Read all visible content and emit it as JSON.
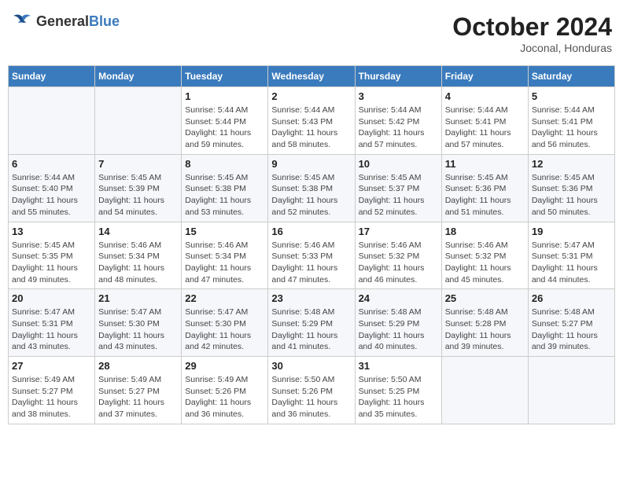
{
  "header": {
    "logo_general": "General",
    "logo_blue": "Blue",
    "month_year": "October 2024",
    "location": "Joconal, Honduras"
  },
  "days_of_week": [
    "Sunday",
    "Monday",
    "Tuesday",
    "Wednesday",
    "Thursday",
    "Friday",
    "Saturday"
  ],
  "weeks": [
    [
      {
        "day": "",
        "info": ""
      },
      {
        "day": "",
        "info": ""
      },
      {
        "day": "1",
        "info": "Sunrise: 5:44 AM\nSunset: 5:44 PM\nDaylight: 11 hours and 59 minutes."
      },
      {
        "day": "2",
        "info": "Sunrise: 5:44 AM\nSunset: 5:43 PM\nDaylight: 11 hours and 58 minutes."
      },
      {
        "day": "3",
        "info": "Sunrise: 5:44 AM\nSunset: 5:42 PM\nDaylight: 11 hours and 57 minutes."
      },
      {
        "day": "4",
        "info": "Sunrise: 5:44 AM\nSunset: 5:41 PM\nDaylight: 11 hours and 57 minutes."
      },
      {
        "day": "5",
        "info": "Sunrise: 5:44 AM\nSunset: 5:41 PM\nDaylight: 11 hours and 56 minutes."
      }
    ],
    [
      {
        "day": "6",
        "info": "Sunrise: 5:44 AM\nSunset: 5:40 PM\nDaylight: 11 hours and 55 minutes."
      },
      {
        "day": "7",
        "info": "Sunrise: 5:45 AM\nSunset: 5:39 PM\nDaylight: 11 hours and 54 minutes."
      },
      {
        "day": "8",
        "info": "Sunrise: 5:45 AM\nSunset: 5:38 PM\nDaylight: 11 hours and 53 minutes."
      },
      {
        "day": "9",
        "info": "Sunrise: 5:45 AM\nSunset: 5:38 PM\nDaylight: 11 hours and 52 minutes."
      },
      {
        "day": "10",
        "info": "Sunrise: 5:45 AM\nSunset: 5:37 PM\nDaylight: 11 hours and 52 minutes."
      },
      {
        "day": "11",
        "info": "Sunrise: 5:45 AM\nSunset: 5:36 PM\nDaylight: 11 hours and 51 minutes."
      },
      {
        "day": "12",
        "info": "Sunrise: 5:45 AM\nSunset: 5:36 PM\nDaylight: 11 hours and 50 minutes."
      }
    ],
    [
      {
        "day": "13",
        "info": "Sunrise: 5:45 AM\nSunset: 5:35 PM\nDaylight: 11 hours and 49 minutes."
      },
      {
        "day": "14",
        "info": "Sunrise: 5:46 AM\nSunset: 5:34 PM\nDaylight: 11 hours and 48 minutes."
      },
      {
        "day": "15",
        "info": "Sunrise: 5:46 AM\nSunset: 5:34 PM\nDaylight: 11 hours and 47 minutes."
      },
      {
        "day": "16",
        "info": "Sunrise: 5:46 AM\nSunset: 5:33 PM\nDaylight: 11 hours and 47 minutes."
      },
      {
        "day": "17",
        "info": "Sunrise: 5:46 AM\nSunset: 5:32 PM\nDaylight: 11 hours and 46 minutes."
      },
      {
        "day": "18",
        "info": "Sunrise: 5:46 AM\nSunset: 5:32 PM\nDaylight: 11 hours and 45 minutes."
      },
      {
        "day": "19",
        "info": "Sunrise: 5:47 AM\nSunset: 5:31 PM\nDaylight: 11 hours and 44 minutes."
      }
    ],
    [
      {
        "day": "20",
        "info": "Sunrise: 5:47 AM\nSunset: 5:31 PM\nDaylight: 11 hours and 43 minutes."
      },
      {
        "day": "21",
        "info": "Sunrise: 5:47 AM\nSunset: 5:30 PM\nDaylight: 11 hours and 43 minutes."
      },
      {
        "day": "22",
        "info": "Sunrise: 5:47 AM\nSunset: 5:30 PM\nDaylight: 11 hours and 42 minutes."
      },
      {
        "day": "23",
        "info": "Sunrise: 5:48 AM\nSunset: 5:29 PM\nDaylight: 11 hours and 41 minutes."
      },
      {
        "day": "24",
        "info": "Sunrise: 5:48 AM\nSunset: 5:29 PM\nDaylight: 11 hours and 40 minutes."
      },
      {
        "day": "25",
        "info": "Sunrise: 5:48 AM\nSunset: 5:28 PM\nDaylight: 11 hours and 39 minutes."
      },
      {
        "day": "26",
        "info": "Sunrise: 5:48 AM\nSunset: 5:27 PM\nDaylight: 11 hours and 39 minutes."
      }
    ],
    [
      {
        "day": "27",
        "info": "Sunrise: 5:49 AM\nSunset: 5:27 PM\nDaylight: 11 hours and 38 minutes."
      },
      {
        "day": "28",
        "info": "Sunrise: 5:49 AM\nSunset: 5:27 PM\nDaylight: 11 hours and 37 minutes."
      },
      {
        "day": "29",
        "info": "Sunrise: 5:49 AM\nSunset: 5:26 PM\nDaylight: 11 hours and 36 minutes."
      },
      {
        "day": "30",
        "info": "Sunrise: 5:50 AM\nSunset: 5:26 PM\nDaylight: 11 hours and 36 minutes."
      },
      {
        "day": "31",
        "info": "Sunrise: 5:50 AM\nSunset: 5:25 PM\nDaylight: 11 hours and 35 minutes."
      },
      {
        "day": "",
        "info": ""
      },
      {
        "day": "",
        "info": ""
      }
    ]
  ]
}
